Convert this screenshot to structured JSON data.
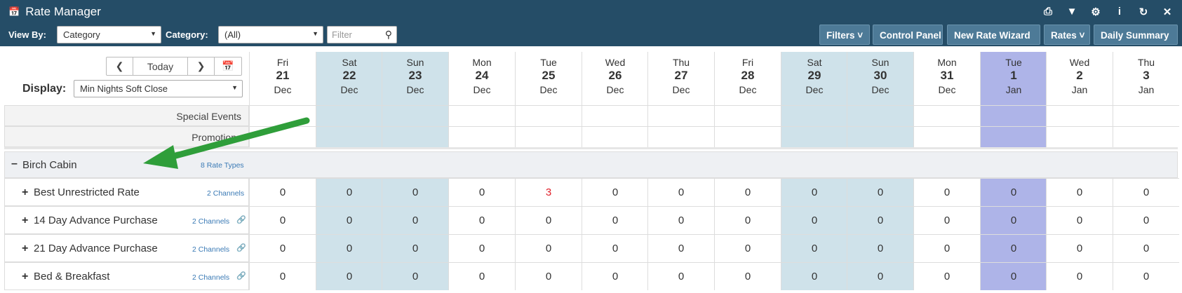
{
  "app": {
    "title": "Rate Manager"
  },
  "toolbar": {
    "view_by_label": "View By:",
    "view_by_value": "Category",
    "category_label": "Category:",
    "category_value": "(All)",
    "filter_placeholder": "Filter",
    "buttons": [
      "Filters",
      "Control Panel",
      "New Rate Wizard",
      "Rates",
      "Daily Summary"
    ]
  },
  "left": {
    "today": "Today",
    "display_label": "Display:",
    "display_value": "Min Nights Soft Close"
  },
  "columns": [
    {
      "dow": "Fri",
      "day": "21",
      "mon": "Dec",
      "shade": "none"
    },
    {
      "dow": "Sat",
      "day": "22",
      "mon": "Dec",
      "shade": "weekend"
    },
    {
      "dow": "Sun",
      "day": "23",
      "mon": "Dec",
      "shade": "weekend"
    },
    {
      "dow": "Mon",
      "day": "24",
      "mon": "Dec",
      "shade": "none"
    },
    {
      "dow": "Tue",
      "day": "25",
      "mon": "Dec",
      "shade": "none"
    },
    {
      "dow": "Wed",
      "day": "26",
      "mon": "Dec",
      "shade": "none"
    },
    {
      "dow": "Thu",
      "day": "27",
      "mon": "Dec",
      "shade": "none"
    },
    {
      "dow": "Fri",
      "day": "28",
      "mon": "Dec",
      "shade": "none"
    },
    {
      "dow": "Sat",
      "day": "29",
      "mon": "Dec",
      "shade": "weekend"
    },
    {
      "dow": "Sun",
      "day": "30",
      "mon": "Dec",
      "shade": "weekend"
    },
    {
      "dow": "Mon",
      "day": "31",
      "mon": "Dec",
      "shade": "none"
    },
    {
      "dow": "Tue",
      "day": "1",
      "mon": "Jan",
      "shade": "today"
    },
    {
      "dow": "Wed",
      "day": "2",
      "mon": "Jan",
      "shade": "none"
    },
    {
      "dow": "Thu",
      "day": "3",
      "mon": "Jan",
      "shade": "none"
    }
  ],
  "info_rows": [
    "Special Events",
    "Promotions"
  ],
  "group": {
    "name": "Birch Cabin",
    "rate_types": "8 Rate Types"
  },
  "rate_rows": [
    {
      "name": "Best Unrestricted Rate",
      "channels": "2 Channels",
      "linked": false,
      "values": [
        "0",
        "0",
        "0",
        "0",
        "3",
        "0",
        "0",
        "0",
        "0",
        "0",
        "0",
        "0",
        "0",
        "0"
      ]
    },
    {
      "name": "14 Day Advance Purchase",
      "channels": "2 Channels",
      "linked": true,
      "values": [
        "0",
        "0",
        "0",
        "0",
        "0",
        "0",
        "0",
        "0",
        "0",
        "0",
        "0",
        "0",
        "0",
        "0"
      ]
    },
    {
      "name": "21 Day Advance Purchase",
      "channels": "2 Channels",
      "linked": true,
      "values": [
        "0",
        "0",
        "0",
        "0",
        "0",
        "0",
        "0",
        "0",
        "0",
        "0",
        "0",
        "0",
        "0",
        "0"
      ]
    },
    {
      "name": "Bed & Breakfast",
      "channels": "2 Channels",
      "linked": true,
      "values": [
        "0",
        "0",
        "0",
        "0",
        "0",
        "0",
        "0",
        "0",
        "0",
        "0",
        "0",
        "0",
        "0",
        "0"
      ]
    }
  ],
  "colors": {
    "header": "#254d67",
    "weekend": "#cfe2ea",
    "today": "#aeb4e8",
    "highlight_value": "#e0202a",
    "arrow": "#2f9e3a",
    "channel_link": "#3a7ab5"
  },
  "icons": {
    "title": "calendar-icon",
    "header": [
      "print-icon",
      "filter-icon",
      "gear-icon",
      "info-icon",
      "refresh-icon",
      "close-icon"
    ]
  }
}
